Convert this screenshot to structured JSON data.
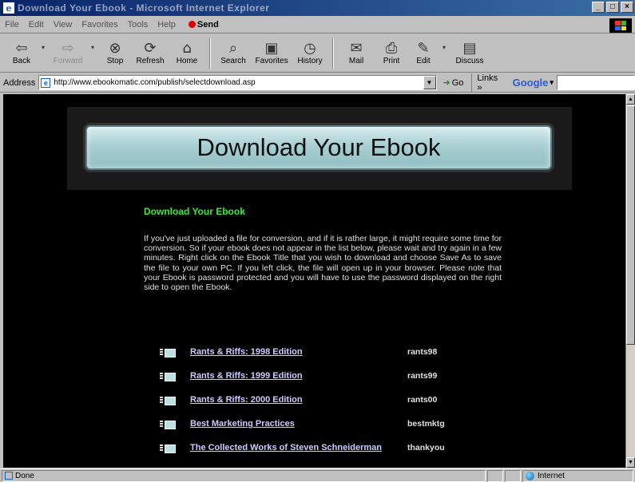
{
  "window": {
    "title": "Download Your Ebook - Microsoft Internet Explorer",
    "controls": [
      "_",
      "□",
      "×"
    ]
  },
  "menu": {
    "items": [
      "File",
      "Edit",
      "View",
      "Favorites",
      "Tools",
      "Help"
    ],
    "send_label": "Send"
  },
  "toolbar": {
    "back": "Back",
    "forward": "Forward",
    "stop": "Stop",
    "refresh": "Refresh",
    "home": "Home",
    "search": "Search",
    "favorites": "Favorites",
    "history": "History",
    "mail": "Mail",
    "print": "Print",
    "edit": "Edit",
    "discuss": "Discuss"
  },
  "address": {
    "label": "Address",
    "url": "http://www.ebookomatic.com/publish/selectdownload.asp",
    "go_label": "Go",
    "links_label": "Links »",
    "google_label": "Google",
    "google_query": ""
  },
  "page": {
    "banner_title": "Download Your Ebook",
    "section_title": "Download Your Ebook",
    "intro": "If you've just uploaded a file for conversion, and if it is rather large, it might require some time for conversion. So if your ebook does not appear in the list below, please wait and try again in a few minutes. Right click on the Ebook Title that you wish to download and choose Save As to save the file to your own PC. If you left click, the file will open up in your browser. Please note that your Ebook is password protected and you will have to use the password displayed on the right side to open the Ebook.",
    "ebooks": [
      {
        "title": "Rants & Riffs: 1998 Edition",
        "password": "rants98"
      },
      {
        "title": "Rants & Riffs: 1999 Edition",
        "password": "rants99"
      },
      {
        "title": "Rants & Riffs: 2000 Edition",
        "password": "rants00"
      },
      {
        "title": "Best Marketing Practices",
        "password": "bestmktg"
      },
      {
        "title": "The Collected Works of Steven Schneiderman",
        "password": "thankyou"
      }
    ]
  },
  "status": {
    "text": "Done",
    "zone": "Internet"
  },
  "colors": {
    "page_background": "#000000",
    "section_title": "#33ee33",
    "link": "#ccccff",
    "banner": "#a9cfd2"
  }
}
